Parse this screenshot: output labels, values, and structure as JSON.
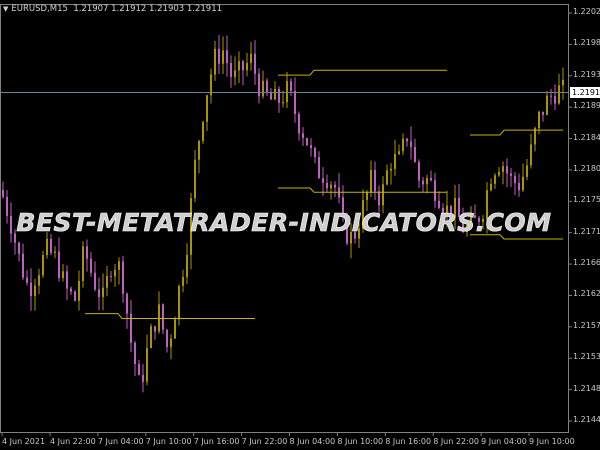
{
  "header": {
    "symbol": "EURUSD,M15",
    "ohlc": "1.21907 1.21912 1.21903 1.21911"
  },
  "colors": {
    "bull": "#a89600",
    "bear": "#c060c0",
    "level": "#c8b400",
    "price_line": "#6a8496",
    "axis": "#808080"
  },
  "watermark": "BEST-METATRADER-INDICATORS.COM",
  "current_price": "1.21911",
  "chart_data": {
    "type": "candlestick",
    "symbol": "EURUSD",
    "timeframe": "M15",
    "ylim": [
      1.2144,
      1.22025
    ],
    "y_ticks": [
      "1.22025",
      "1.21980",
      "1.21935",
      "1.21890",
      "1.21845",
      "1.21800",
      "1.21755",
      "1.21710",
      "1.21665",
      "1.21620",
      "1.21575",
      "1.21530",
      "1.21485",
      "1.21440"
    ],
    "x_ticks": [
      "4 Jun 2021",
      "4 Jun 22:00",
      "7 Jun 04:00",
      "7 Jun 10:00",
      "7 Jun 16:00",
      "7 Jun 22:00",
      "8 Jun 04:00",
      "8 Jun 10:00",
      "8 Jun 16:00",
      "8 Jun 22:00",
      "9 Jun 04:00",
      "9 Jun 10:00"
    ],
    "close_path": [
      1.21771,
      1.21728,
      1.21671,
      1.21628,
      1.21657,
      1.21685,
      1.21671,
      1.21628,
      1.21614,
      1.21685,
      1.21642,
      1.21614,
      1.21671,
      1.21657,
      1.21556,
      1.21485,
      1.21556,
      1.21599,
      1.21542,
      1.21614,
      1.21685,
      1.21814,
      1.219,
      1.21958,
      1.21972,
      1.21929,
      1.21943,
      1.21958,
      1.21915,
      1.219,
      1.219,
      1.21915,
      1.21872,
      1.21843,
      1.218,
      1.21793,
      1.21779,
      1.21714,
      1.217,
      1.21743,
      1.21786,
      1.21757,
      1.21814,
      1.21814,
      1.21857,
      1.21786,
      1.21786,
      1.21771,
      1.21743,
      1.21743,
      1.21714,
      1.21721,
      1.21743,
      1.218,
      1.21814,
      1.21786,
      1.21779,
      1.21814,
      1.21872,
      1.219,
      1.21915,
      1.21912
    ],
    "levels": [
      {
        "from": 1.21594,
        "to": 1.21587
      },
      {
        "from": 1.21774,
        "to": 1.21768
      },
      {
        "from": 1.21936,
        "to": 1.21943
      },
      {
        "from": 1.2185,
        "to": 1.21857
      },
      {
        "from": 1.21707,
        "to": 1.21701
      }
    ]
  }
}
